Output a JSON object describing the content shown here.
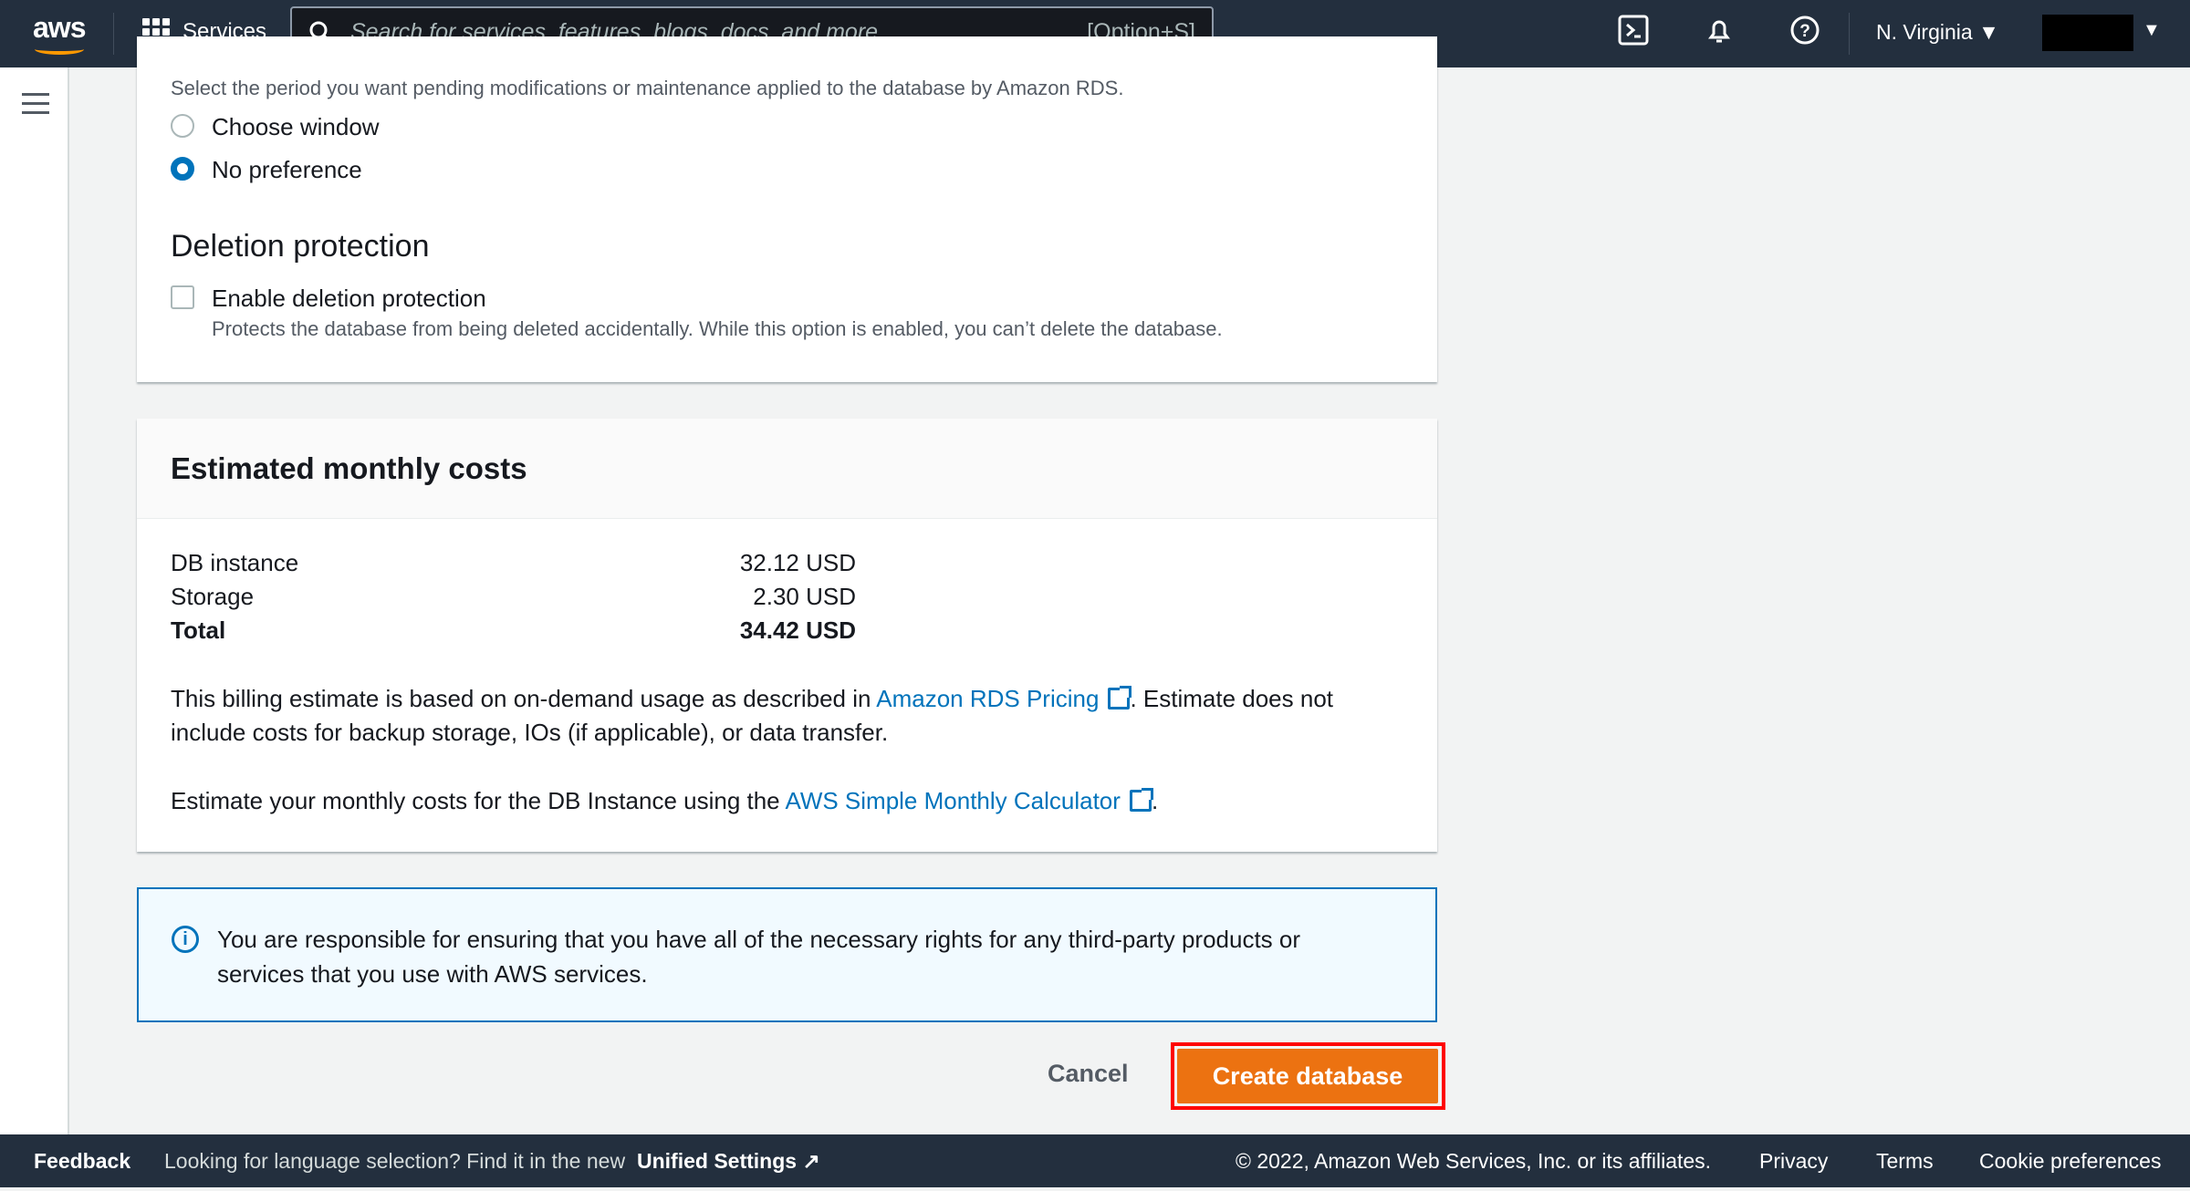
{
  "header": {
    "logo": "aws",
    "services": "Services",
    "search_placeholder": "Search for services, features, blogs, docs, and more",
    "search_shortcut": "[Option+S]",
    "region": "N. Virginia"
  },
  "maintenance": {
    "description": "Select the period you want pending modifications or maintenance applied to the database by Amazon RDS.",
    "options": [
      {
        "label": "Choose window",
        "selected": false
      },
      {
        "label": "No preference",
        "selected": true
      }
    ]
  },
  "deletion": {
    "heading": "Deletion protection",
    "checkbox_label": "Enable deletion protection",
    "checked": false,
    "help": "Protects the database from being deleted accidentally. While this option is enabled, you can’t delete the database."
  },
  "costs": {
    "title": "Estimated monthly costs",
    "rows": [
      {
        "label": "DB instance",
        "value": "32.12 USD"
      },
      {
        "label": "Storage",
        "value": "2.30 USD"
      },
      {
        "label": "Total",
        "value": "34.42 USD"
      }
    ],
    "p1_a": "This billing estimate is based on on-demand usage as described in ",
    "p1_link": "Amazon RDS Pricing",
    "p1_b": ". Estimate does not",
    "p1_c": "include costs for backup storage, IOs (if applicable), or data transfer.",
    "p2_a": "Estimate your monthly costs for the DB Instance using the ",
    "p2_link": "AWS Simple Monthly Calculator",
    "p2_b": "."
  },
  "info": {
    "line1": "You are responsible for ensuring that you have all of the necessary rights for any third-party products or",
    "line2": "services that you use with AWS services."
  },
  "actions": {
    "cancel": "Cancel",
    "create": "Create database"
  },
  "footer": {
    "feedback": "Feedback",
    "lang_text": "Looking for language selection? Find it in the new",
    "unified": "Unified Settings",
    "copyright": "© 2022, Amazon Web Services, Inc. or its affiliates.",
    "privacy": "Privacy",
    "terms": "Terms",
    "cookies": "Cookie preferences"
  },
  "colors": {
    "accent": "#0073bb",
    "primary_button": "#ec7211",
    "header": "#232f3e",
    "highlight": "#ff0000"
  }
}
